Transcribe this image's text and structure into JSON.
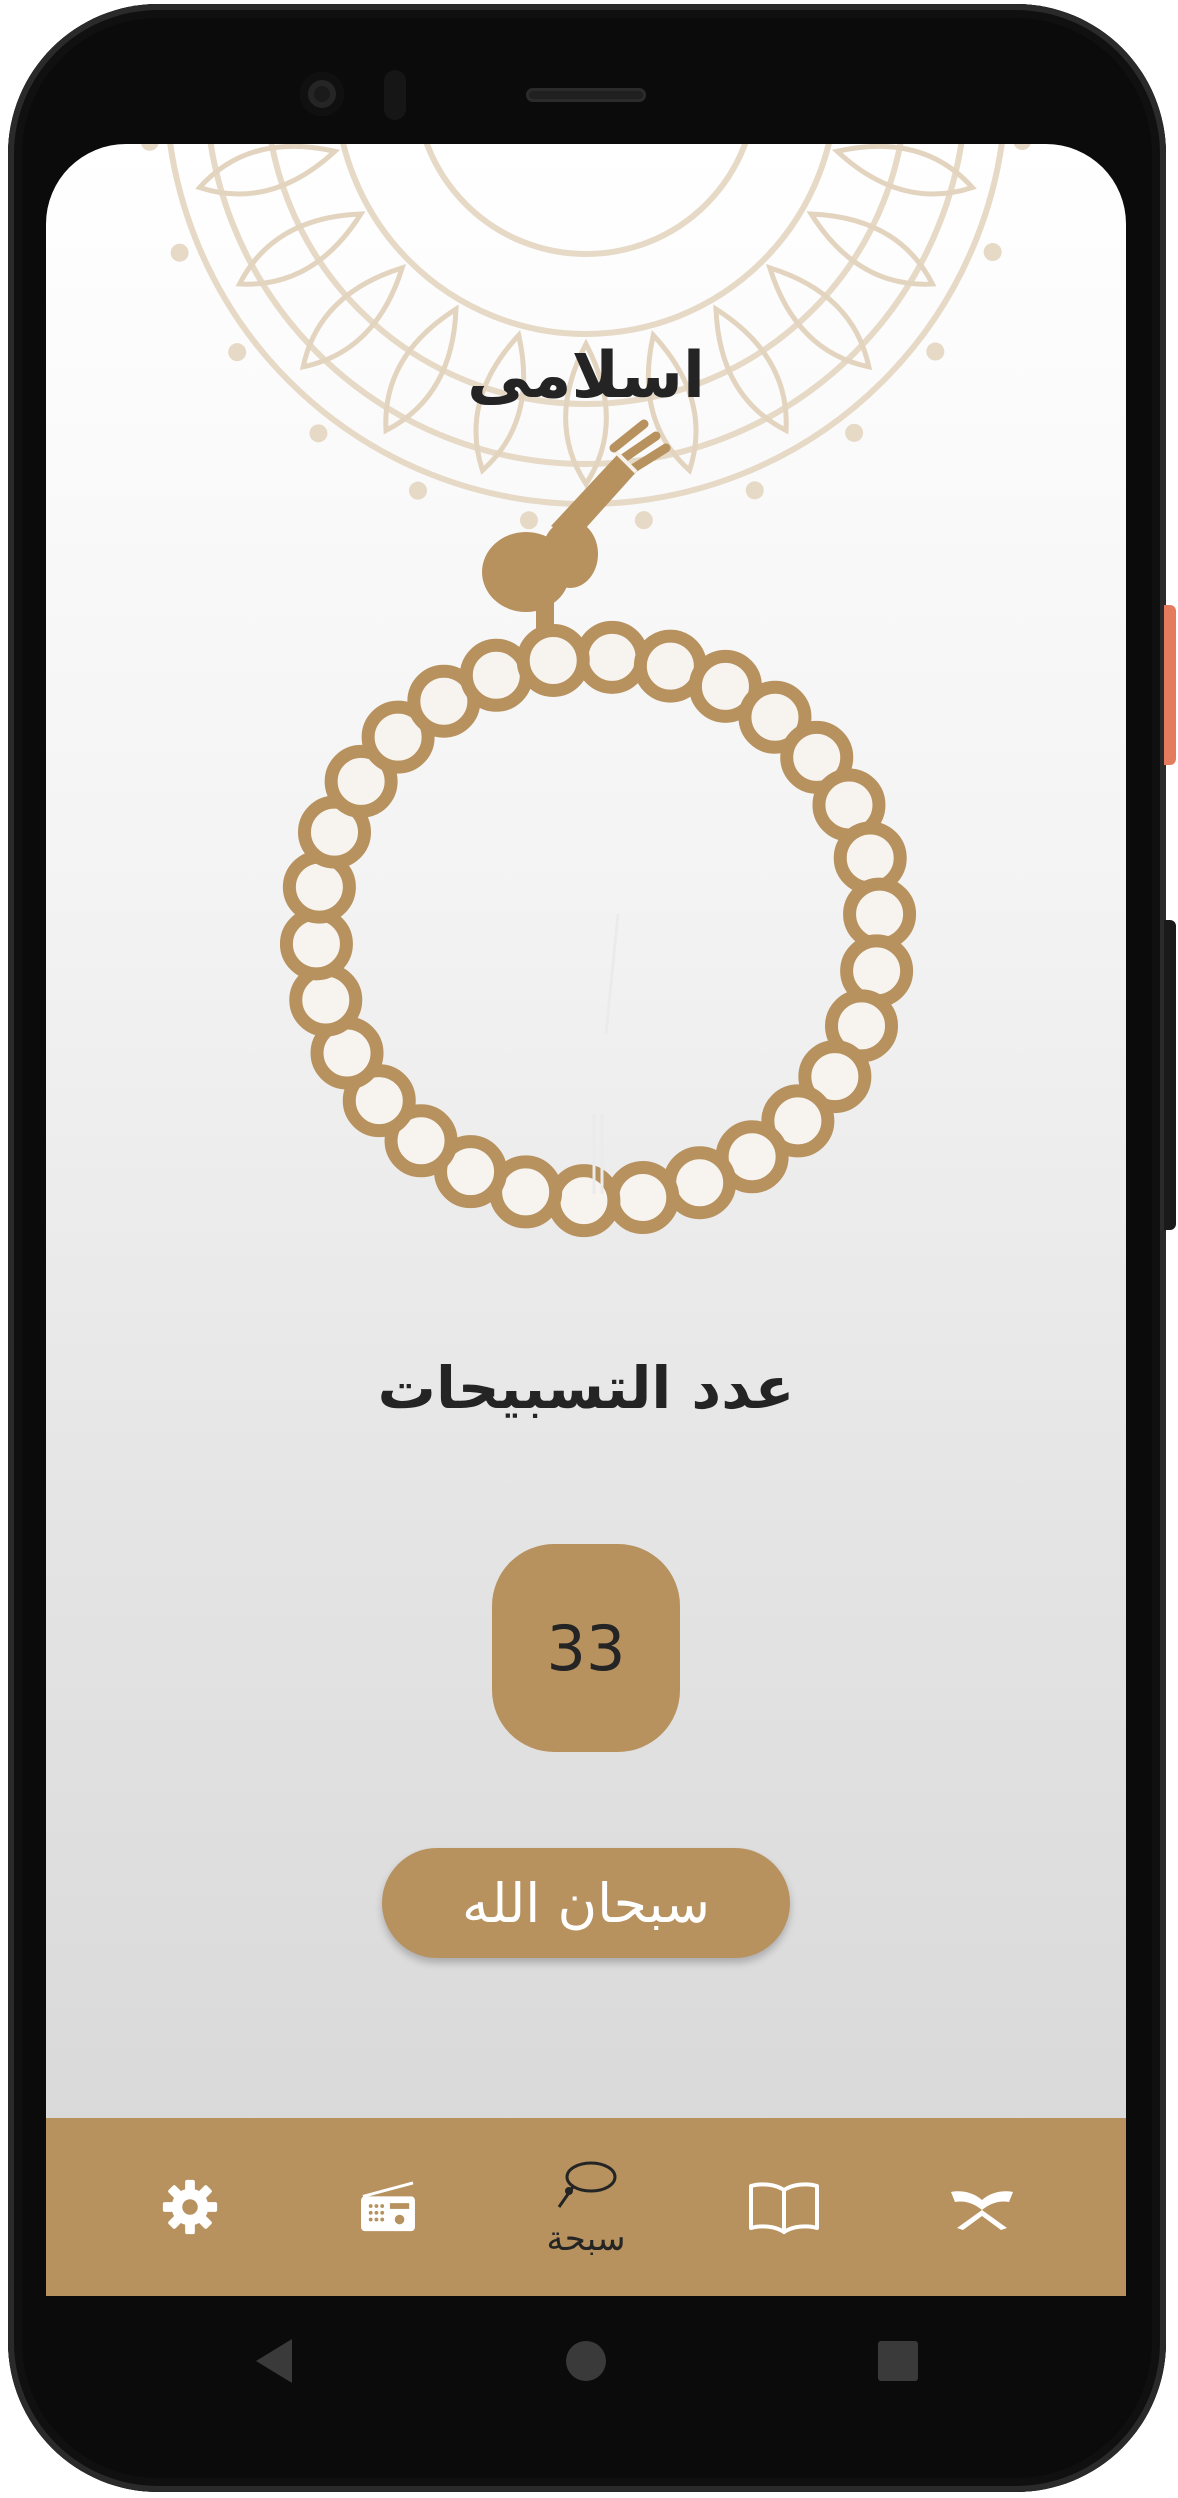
{
  "app": {
    "title": "اسلامى"
  },
  "sebha": {
    "counter_label": "عدد التسبيحات",
    "count": "33",
    "tasbeeh_button_label": "سبحان الله"
  },
  "bottom_nav": {
    "items": [
      {
        "icon": "gear-icon",
        "label": "",
        "selected": false
      },
      {
        "icon": "radio-icon",
        "label": "",
        "selected": false
      },
      {
        "icon": "sebha-icon",
        "label": "سبحة",
        "selected": true
      },
      {
        "icon": "book-icon",
        "label": "",
        "selected": false
      },
      {
        "icon": "quran-icon",
        "label": "",
        "selected": false
      }
    ]
  },
  "colors": {
    "accent": "#b7925f",
    "text_dark": "#242424",
    "icon_light": "#ffffff"
  },
  "system_nav": {
    "items": [
      "back-icon",
      "home-icon",
      "recents-icon"
    ]
  }
}
